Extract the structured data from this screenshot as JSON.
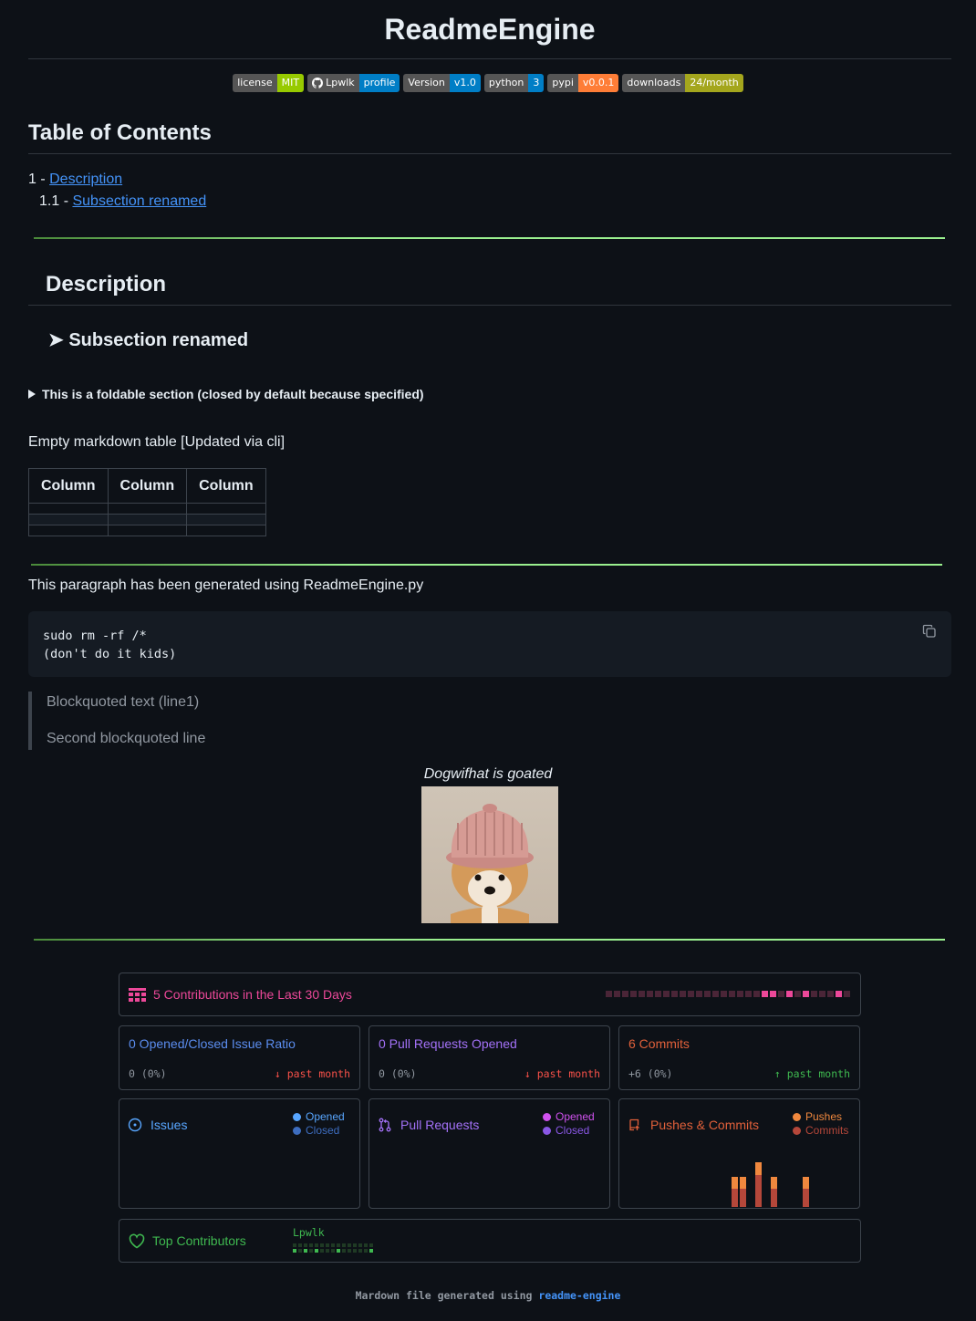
{
  "title": "ReadmeEngine",
  "badges": [
    {
      "label": "license",
      "value": "MIT",
      "color": "#97ca00"
    },
    {
      "label": "Lpwlk",
      "value": "profile",
      "color": "#007ec6",
      "icon": "github-icon"
    },
    {
      "label": "Version",
      "value": "v1.0",
      "color": "#007ec6"
    },
    {
      "label": "python",
      "value": "3",
      "color": "#007ec6"
    },
    {
      "label": "pypi",
      "value": "v0.0.1",
      "color": "#fe7d37"
    },
    {
      "label": "downloads",
      "value": "24/month",
      "color": "#a4a61d"
    }
  ],
  "toc": {
    "heading": "Table of Contents",
    "items": [
      {
        "num": "1 -",
        "label": "Description"
      },
      {
        "num": "1.1 -",
        "label": "Subsection renamed"
      }
    ]
  },
  "description": {
    "heading": "Description",
    "subsection": "➤ Subsection renamed",
    "details_summary": "This is a foldable section (closed by default because specified)",
    "table_caption": "Empty markdown table [Updated via cli]",
    "table_headers": [
      "Column",
      "Column",
      "Column"
    ]
  },
  "generated_paragraph": "This paragraph has been generated using ReadmeEngine.py",
  "code_lines": [
    "sudo rm -rf /*",
    "(don't do it kids)"
  ],
  "blockquote": [
    "Blockquoted text (line1)",
    "Second blockquoted line"
  ],
  "image_caption": "Dogwifhat is goated",
  "stats": {
    "contributions": {
      "title": "5 Contributions in the Last 30 Days",
      "color": "#ec4899"
    },
    "issue_ratio": {
      "title": "0 Opened/Closed Issue Ratio",
      "value": "0 (0%)",
      "trend": "↓ past month",
      "title_color": "#5b8def",
      "trend_color": "#f85149"
    },
    "pull_requests_opened": {
      "title": "0 Pull Requests Opened",
      "value": "0 (0%)",
      "trend": "↓ past month",
      "title_color": "#a371f7",
      "trend_color": "#f85149"
    },
    "commits": {
      "title": "6 Commits",
      "value": "+6 (0%)",
      "trend": "↑ past month",
      "title_color": "#e0603a",
      "trend_color": "#3fb950"
    },
    "issues_panel": {
      "title": "Issues",
      "legend": [
        "Opened",
        "Closed"
      ],
      "colors": [
        "#58a6ff",
        "#3d6dbf"
      ]
    },
    "pr_panel": {
      "title": "Pull Requests",
      "legend": [
        "Opened",
        "Closed"
      ],
      "colors": [
        "#d152f0",
        "#8957e5"
      ]
    },
    "pushes_panel": {
      "title": "Pushes & Commits",
      "legend": [
        "Pushes",
        "Commits"
      ],
      "colors": [
        "#f0883e",
        "#b5473a"
      ]
    },
    "top_contributors": {
      "title": "Top Contributors",
      "user": "Lpwlk",
      "color": "#3fb950"
    }
  },
  "footer": {
    "text": "Mardown file generated using",
    "link": "readme-engine"
  }
}
